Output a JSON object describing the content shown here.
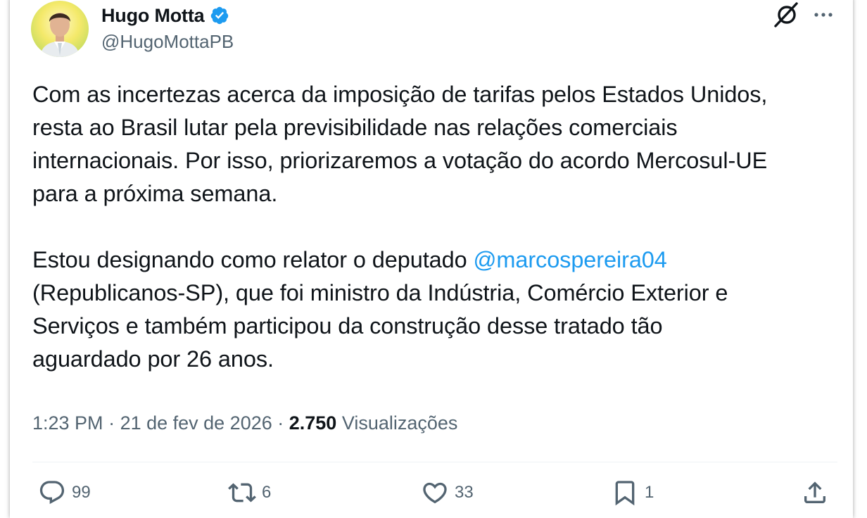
{
  "author": {
    "name": "Hugo Motta",
    "handle": "@HugoMottaPB"
  },
  "tweet": {
    "paragraph1": "Com as incertezas acerca da imposição de tarifas pelos Estados Unidos,\nresta ao Brasil lutar pela previsibilidade nas relações comerciais\ninternacionais. Por isso, priorizaremos a votação do acordo Mercosul-UE\npara a próxima semana.",
    "paragraph2_before": "Estou designando como relator o deputado ",
    "mention": "@marcospereira04",
    "paragraph2_after": "\n(Republicanos-SP), que foi ministro da Indústria, Comércio Exterior e\nServiços e também participou da construção desse tratado tão\naguardado por 26 anos."
  },
  "meta": {
    "time": "1:23 PM",
    "separator": " · ",
    "date": "21 de fev de 2026",
    "views_count": "2.750",
    "views_label": " Visualizações"
  },
  "actions": {
    "replies": "99",
    "reposts": "6",
    "likes": "33",
    "bookmarks": "1"
  },
  "icons": {
    "verified": "verified-badge-icon",
    "grok": "grok-icon",
    "more": "more-options-icon",
    "reply": "reply-icon",
    "repost": "repost-icon",
    "like": "heart-icon",
    "bookmark": "bookmark-icon",
    "share": "share-icon"
  },
  "colors": {
    "text": "#0f1419",
    "secondary": "#536471",
    "link": "#1d9bf0",
    "verified": "#1d9bf0"
  }
}
